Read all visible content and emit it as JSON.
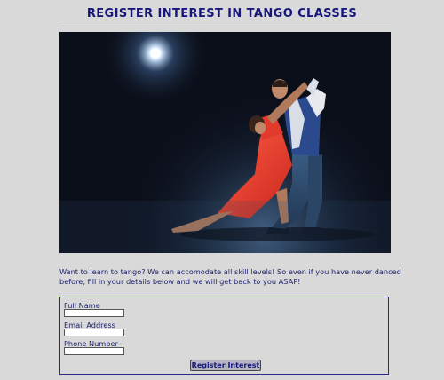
{
  "page": {
    "title": "REGISTER INTEREST IN TANGO CLASSES",
    "intro": "Want to learn to tango? We can accomodate all skill levels! So even if you have never danced before, fill in your details below and we will get back to you ASAP!"
  },
  "hero": {
    "icon": "tango-dancers-photo"
  },
  "form": {
    "fields": [
      {
        "label": "Full Name",
        "value": "",
        "placeholder": ""
      },
      {
        "label": "Email Address",
        "value": "",
        "placeholder": ""
      },
      {
        "label": "Phone Number",
        "value": "",
        "placeholder": ""
      }
    ],
    "submit_label": "Register Interest"
  },
  "colors": {
    "background": "#d9d9d9",
    "heading": "#17177a",
    "text": "#1c1f6b",
    "form_border": "#2a2d86",
    "button": "#b4b4c4"
  }
}
